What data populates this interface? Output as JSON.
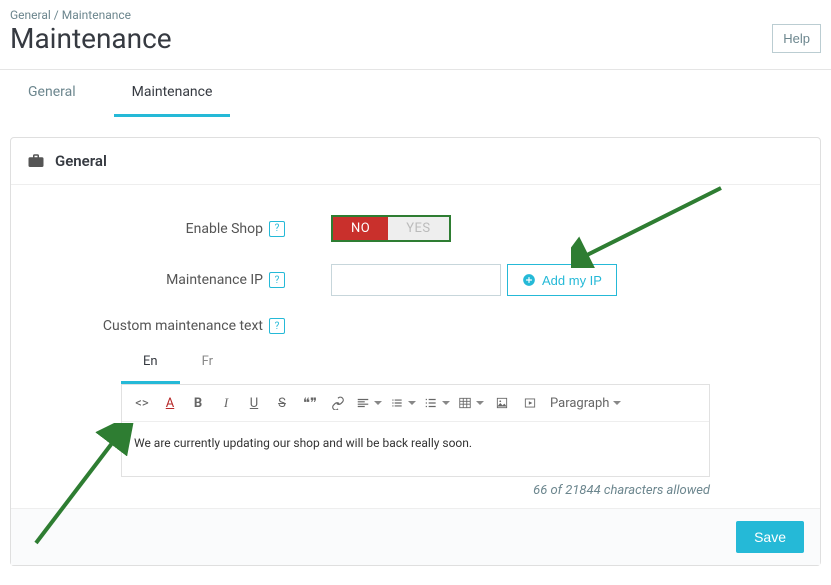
{
  "breadcrumb": {
    "a": "General",
    "sep": "/",
    "b": "Maintenance"
  },
  "page_title": "Maintenance",
  "help_label": "Help",
  "tabs": {
    "general": "General",
    "maintenance": "Maintenance"
  },
  "panel_title": "General",
  "labels": {
    "enable_shop": "Enable Shop",
    "maintenance_ip": "Maintenance IP",
    "custom_text": "Custom maintenance text"
  },
  "toggle": {
    "no": "NO",
    "yes": "YES"
  },
  "ip_value": "",
  "add_ip_label": "Add my IP",
  "lang_tabs": {
    "en": "En",
    "fr": "Fr"
  },
  "toolbar": {
    "paragraph": "Paragraph",
    "bold": "B",
    "italic": "I",
    "underline": "U",
    "strike": "S",
    "quote": "❝❞",
    "code": "<>"
  },
  "editor_text": "We are currently updating our shop and will be back really soon.",
  "char_count": "66 of 21844 characters allowed",
  "save_label": "Save",
  "help_q": "?"
}
